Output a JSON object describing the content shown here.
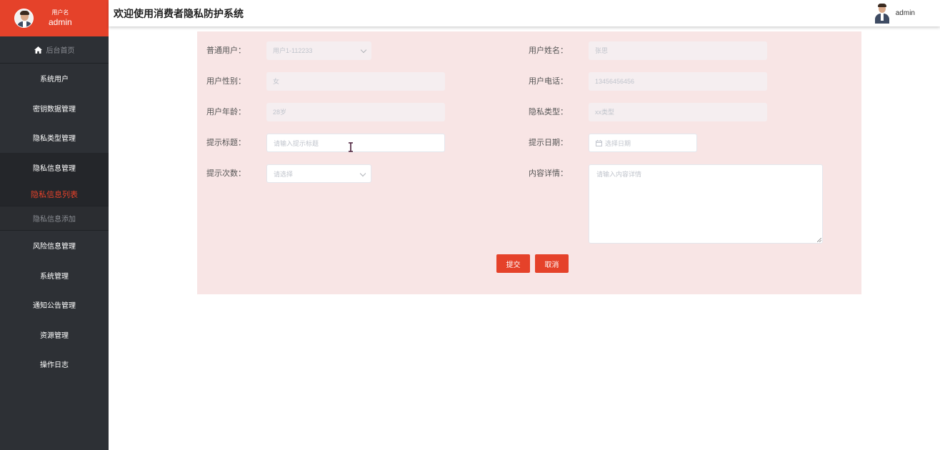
{
  "sidebar": {
    "user": {
      "label": "用户名",
      "name": "admin"
    },
    "home": "后台首页",
    "items": [
      {
        "label": "系统用户"
      },
      {
        "label": "密钥数据管理"
      },
      {
        "label": "隐私类型管理"
      },
      {
        "label": "隐私信息管理"
      },
      {
        "label": "风险信息管理"
      },
      {
        "label": "系统管理"
      },
      {
        "label": "通知公告管理"
      },
      {
        "label": "资源管理"
      },
      {
        "label": "操作日志"
      }
    ],
    "sub_items": [
      {
        "label": "隐私信息列表",
        "state": "active"
      },
      {
        "label": "隐私信息添加",
        "state": "normal"
      }
    ]
  },
  "header": {
    "title": "欢迎使用消费者隐私防护系统",
    "username": "admin"
  },
  "form": {
    "user_select": {
      "label": "普通用户：",
      "value": "用户1-112233"
    },
    "user_name": {
      "label": "用户姓名：",
      "value": "张思"
    },
    "gender": {
      "label": "用户性别：",
      "value": "女"
    },
    "phone": {
      "label": "用户电话：",
      "value": "13456456456"
    },
    "age": {
      "label": "用户年龄：",
      "value": "28岁"
    },
    "privacy_type": {
      "label": "隐私类型：",
      "value": "xx类型"
    },
    "tip_title": {
      "label": "提示标题：",
      "placeholder": "请输入提示标题"
    },
    "tip_date": {
      "label": "提示日期：",
      "placeholder": "选择日期"
    },
    "tip_count": {
      "label": "提示次数：",
      "placeholder": "请选择"
    },
    "content": {
      "label": "内容详情：",
      "placeholder": "请输入内容详情"
    },
    "submit": "提交",
    "cancel": "取消"
  },
  "colors": {
    "accent": "#e5422a",
    "sidebar_bg": "#2d3035",
    "panel_bg": "#f8e5e5"
  }
}
